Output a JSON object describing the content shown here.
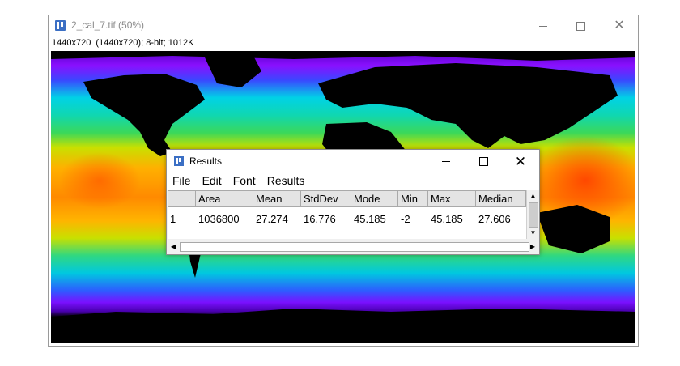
{
  "image_window": {
    "title": "2_cal_7.tif (50%)",
    "info": "1440x720  (1440x720); 8-bit; 1012K",
    "controls": {
      "minimize": "—",
      "maximize": "☐",
      "close": "✕"
    }
  },
  "results_window": {
    "title": "Results",
    "menu": [
      "File",
      "Edit",
      "Font",
      "Results"
    ],
    "columns": [
      "",
      "Area",
      "Mean",
      "StdDev",
      "Mode",
      "Min",
      "Max",
      "Median"
    ],
    "rows": [
      [
        "1",
        "1036800",
        "27.274",
        "16.776",
        "45.185",
        "-2",
        "45.185",
        "27.606"
      ]
    ],
    "controls": {
      "minimize": "—",
      "maximize": "☐",
      "close": "✕"
    }
  },
  "colors": {
    "icon_blue": "#3b6fc4",
    "map_palette": [
      "#000000",
      "#7a00ff",
      "#3a3aff",
      "#00d8e8",
      "#16d6a0",
      "#4fd84a",
      "#d8e000",
      "#ffb400",
      "#ff5a00"
    ]
  }
}
